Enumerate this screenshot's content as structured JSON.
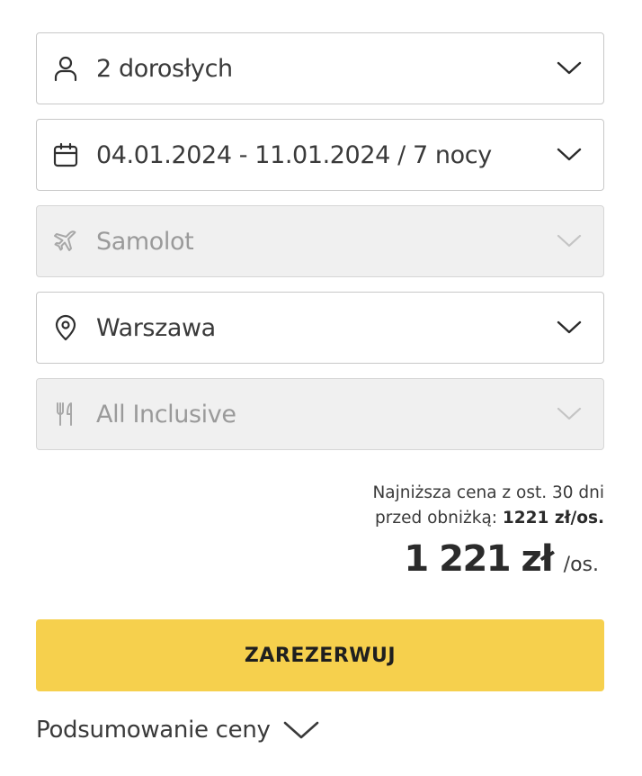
{
  "fields": [
    {
      "id": "travelers",
      "value": "2 dorosłych",
      "icon": "person-icon",
      "disabled": false
    },
    {
      "id": "dates",
      "value": "04.01.2024 - 11.01.2024 / 7 nocy",
      "icon": "calendar-icon",
      "disabled": false
    },
    {
      "id": "transport",
      "value": "Samolot",
      "icon": "airplane-icon",
      "disabled": true
    },
    {
      "id": "departure",
      "value": "Warszawa",
      "icon": "location-pin-icon",
      "disabled": false
    },
    {
      "id": "board",
      "value": "All Inclusive",
      "icon": "fork-knife-icon",
      "disabled": true
    }
  ],
  "price": {
    "lowest_note_line1": "Najniższa cena z ost. 30 dni",
    "lowest_note_prefix": "przed obniżką:",
    "lowest_note_value": "1221 zł/os.",
    "amount": "1 221 zł",
    "unit": "/os."
  },
  "book_button": {
    "label": "ZAREZERWUJ"
  },
  "summary": {
    "label": "Podsumowanie ceny",
    "icon": "chevron-down-icon"
  },
  "colors": {
    "accent": "#f6d04d",
    "border": "#c8c8c8",
    "disabled_bg": "#f0f0f0",
    "text": "#3a3a3a"
  }
}
